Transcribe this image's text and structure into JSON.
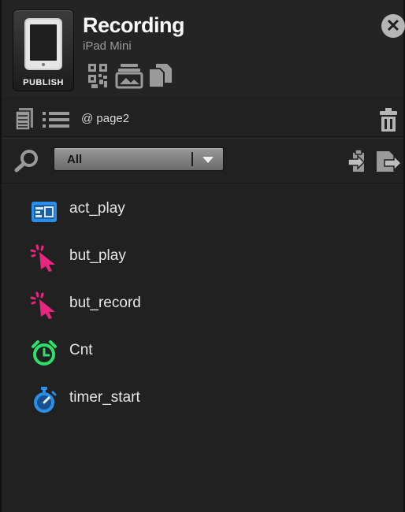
{
  "header": {
    "title": "Recording",
    "device_name": "iPad Mini",
    "publish_label": "PUBLISH",
    "tools": [
      "qr-code-icon",
      "image-stack-icon",
      "copy-pages-icon"
    ],
    "close_icon": "close-icon"
  },
  "page_bar": {
    "page_label": "@ page2",
    "icons": [
      "document-icon",
      "list-view-icon",
      "trash-icon"
    ]
  },
  "filter": {
    "selected": "All",
    "icons": [
      "search-icon",
      "paste-icon",
      "export-icon"
    ]
  },
  "objects": [
    {
      "label": "act_play",
      "icon": "action-icon",
      "color": "#2b8ee8"
    },
    {
      "label": "but_play",
      "icon": "cursor-click-icon",
      "color": "#e9267f"
    },
    {
      "label": "but_record",
      "icon": "cursor-click-icon",
      "color": "#e9267f"
    },
    {
      "label": "Cnt",
      "icon": "alarm-clock-icon",
      "color": "#2ee06a"
    },
    {
      "label": "timer_start",
      "icon": "stopwatch-icon",
      "color": "#2b8ee8"
    }
  ]
}
